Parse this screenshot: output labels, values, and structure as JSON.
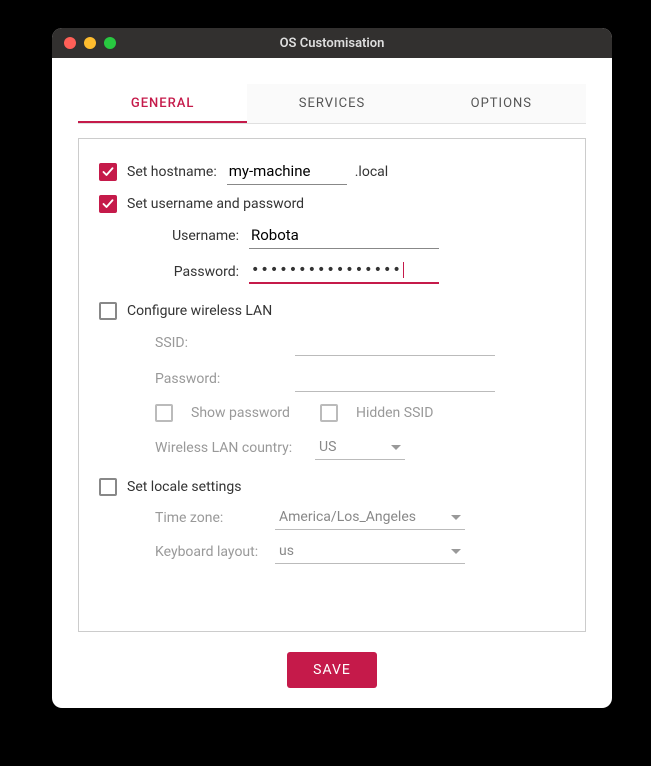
{
  "window": {
    "title": "OS Customisation"
  },
  "tabs": {
    "general": "GENERAL",
    "services": "SERVICES",
    "options": "OPTIONS"
  },
  "hostname": {
    "checkbox_label": "Set hostname:",
    "value": "my-machine",
    "suffix": ".local"
  },
  "userpass": {
    "checkbox_label": "Set username and password",
    "username_label": "Username:",
    "username_value": "Robota",
    "password_label": "Password:",
    "password_mask": "••••••••••••••••"
  },
  "wifi": {
    "checkbox_label": "Configure wireless LAN",
    "ssid_label": "SSID:",
    "ssid_value": "",
    "password_label": "Password:",
    "password_value": "",
    "show_password_label": "Show password",
    "hidden_ssid_label": "Hidden SSID",
    "country_label": "Wireless LAN country:",
    "country_value": "US"
  },
  "locale": {
    "checkbox_label": "Set locale settings",
    "timezone_label": "Time zone:",
    "timezone_value": "America/Los_Angeles",
    "keyboard_label": "Keyboard layout:",
    "keyboard_value": "us"
  },
  "buttons": {
    "save": "SAVE"
  }
}
